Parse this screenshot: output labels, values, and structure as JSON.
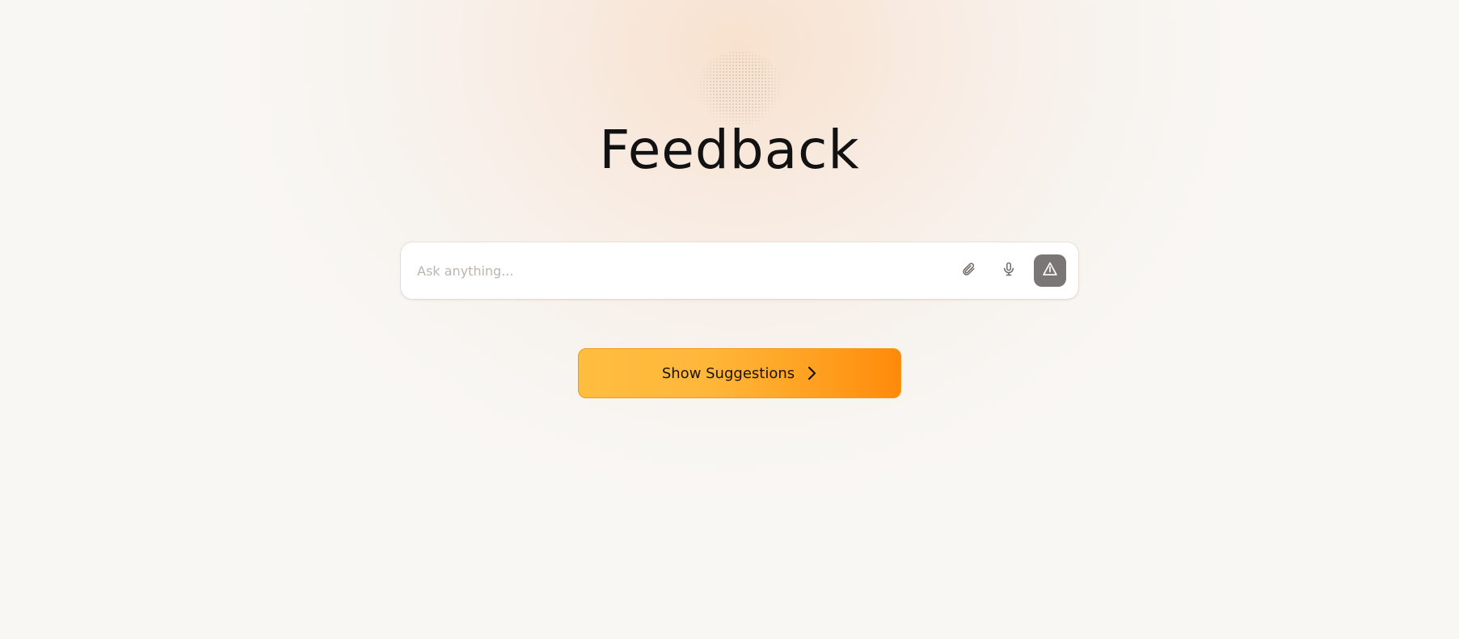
{
  "page": {
    "title": "Feedback"
  },
  "input": {
    "placeholder": "Ask anything...",
    "value": ""
  },
  "icons": {
    "logo": "dotted-orb-logo",
    "attach": "paperclip-icon",
    "mic": "microphone-icon",
    "send": "triangle-send-icon",
    "chevron": "chevron-right-icon"
  },
  "suggestions_button": {
    "label": "Show Suggestions"
  },
  "colors": {
    "accent_start": "#ffbd3f",
    "accent_end": "#ff8a0a",
    "send_button": "#7a7675",
    "title": "#121212",
    "background": "#f9f7f4"
  }
}
